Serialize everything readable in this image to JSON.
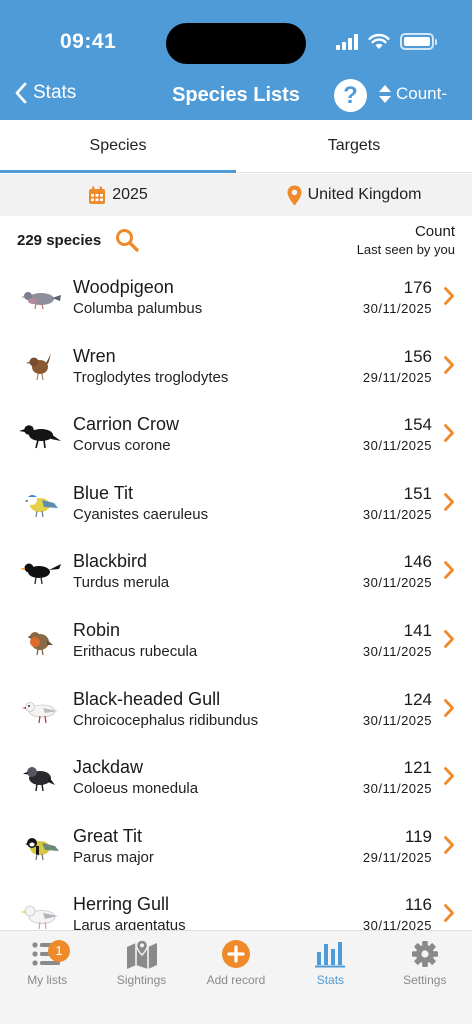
{
  "status": {
    "time": "09:41"
  },
  "nav": {
    "back_label": "Stats",
    "title": "Species Lists",
    "help": "?",
    "sort_label": "Count-"
  },
  "tabs": [
    {
      "label": "Species"
    },
    {
      "label": "Targets"
    }
  ],
  "filters": {
    "year": "2025",
    "region": "United Kingdom"
  },
  "summary": {
    "species_count": "229 species",
    "col_count": "Count",
    "col_last": "Last seen by you"
  },
  "species": [
    {
      "common": "Woodpigeon",
      "latin": "Columba palumbus",
      "count": "176",
      "last": "30/11/2025",
      "icon": "woodpigeon-icon"
    },
    {
      "common": "Wren",
      "latin": "Troglodytes troglodytes",
      "count": "156",
      "last": "29/11/2025",
      "icon": "wren-icon"
    },
    {
      "common": "Carrion Crow",
      "latin": "Corvus corone",
      "count": "154",
      "last": "30/11/2025",
      "icon": "carrion-crow-icon"
    },
    {
      "common": "Blue Tit",
      "latin": "Cyanistes caeruleus",
      "count": "151",
      "last": "30/11/2025",
      "icon": "blue-tit-icon"
    },
    {
      "common": "Blackbird",
      "latin": "Turdus merula",
      "count": "146",
      "last": "30/11/2025",
      "icon": "blackbird-icon"
    },
    {
      "common": "Robin",
      "latin": "Erithacus rubecula",
      "count": "141",
      "last": "30/11/2025",
      "icon": "robin-icon"
    },
    {
      "common": "Black-headed Gull",
      "latin": "Chroicocephalus ridibundus",
      "count": "124",
      "last": "30/11/2025",
      "icon": "black-headed-gull-icon"
    },
    {
      "common": "Jackdaw",
      "latin": "Coloeus monedula",
      "count": "121",
      "last": "30/11/2025",
      "icon": "jackdaw-icon"
    },
    {
      "common": "Great Tit",
      "latin": "Parus major",
      "count": "119",
      "last": "29/11/2025",
      "icon": "great-tit-icon"
    },
    {
      "common": "Herring Gull",
      "latin": "Larus argentatus",
      "count": "116",
      "last": "30/11/2025",
      "icon": "herring-gull-icon"
    }
  ],
  "tabbar": {
    "my_lists": "My lists",
    "my_lists_badge": "1",
    "sightings": "Sightings",
    "add_record": "Add record",
    "stats": "Stats",
    "settings": "Settings"
  },
  "colors": {
    "header": "#4f9bd8",
    "accent": "#ee8a2a",
    "active_tab": "#4f9bd8"
  }
}
